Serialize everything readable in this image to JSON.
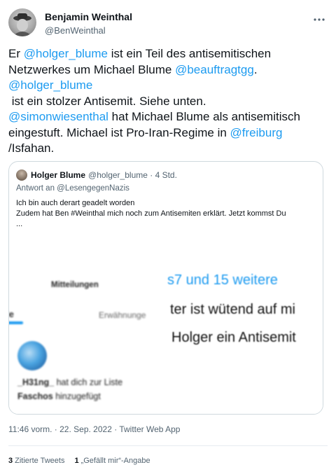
{
  "author": {
    "name": "Benjamin Weinthal",
    "handle": "@BenWeinthal"
  },
  "tweet": {
    "segments": [
      {
        "t": "Er ",
        "m": false
      },
      {
        "t": "@holger_blume",
        "m": true
      },
      {
        "t": " ist ein Teil des antisemitischen\nNetzwerkes um Michael Blume ",
        "m": false
      },
      {
        "t": "@beauftragtgg",
        "m": true
      },
      {
        "t": ".\n",
        "m": false
      },
      {
        "t": "@holger_blume",
        "m": true
      },
      {
        "t": "\n ist ein stolzer Antisemit. Siehe unten.\n",
        "m": false
      },
      {
        "t": "@simonwiesenthal",
        "m": true
      },
      {
        "t": " hat Michael Blume als antisemitisch\neingestuft. Michael ist Pro-Iran-Regime in ",
        "m": false
      },
      {
        "t": "@freiburg",
        "m": true
      },
      {
        "t": "\n/Isfahan.",
        "m": false
      }
    ]
  },
  "quote": {
    "name": "Holger Blume",
    "handle_time": "@holger_blume · 4 Std.",
    "reply_to": "Antwort an @LesengegenNazis",
    "line1": "Ich bin auch derart geadelt worden",
    "line2": "Zudem hat Ben #Weinthal mich noch zum Antisemiten erklärt. Jetzt kommst Du",
    "line3": "...",
    "media": {
      "mitteilungen": "Mitteilungen",
      "le": "le",
      "erwaehnungen": "Erwähnunge",
      "notif_user": "_H31ng_",
      "notif_text1": " hat dich zur Liste",
      "notif_list": "Faschos",
      "notif_text2": " hinzugefügt",
      "big1": "s7 und 15 weitere",
      "big2": "ter ist wütend auf mi",
      "big3": "Holger ein Antisemit"
    }
  },
  "meta": {
    "timestamp": "11:46 vorm. · 22. Sep. 2022 · Twitter Web App",
    "quote_count": "3",
    "quote_label": "Zitierte Tweets",
    "like_count": "1",
    "like_label": "„Gefällt mir“-Angabe"
  },
  "colors": {
    "link": "#1d9bf0",
    "text": "#0f1419",
    "secondary": "#536471",
    "border": "#cfd9de"
  },
  "icons": {
    "more": "more-icon",
    "avatar": "avatar"
  }
}
